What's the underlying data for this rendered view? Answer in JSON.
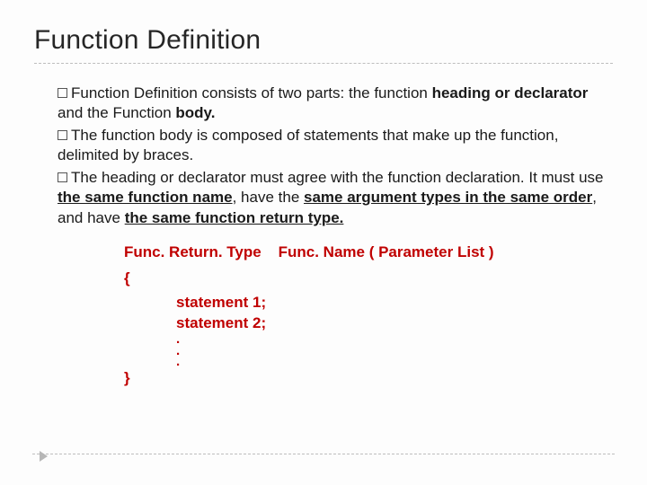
{
  "title": "Function Definition",
  "bullets": {
    "b1": {
      "lead": "Function Definition consists of two parts: the function ",
      "bold1": "heading or declarator",
      "mid1": " and the Function ",
      "bold2": "body."
    },
    "b2": {
      "text": "The function body is composed of statements that make up the function, delimited by braces."
    },
    "b3": {
      "lead": "The heading or declarator must agree with the function declaration. It must use ",
      "u1": "the same function name",
      "mid1": ", have the ",
      "u2": "same argument types in the same order",
      "mid2": ", and have ",
      "u3": "the same function return type."
    }
  },
  "code": {
    "ret": "Func. Return. Type",
    "name": "Func. Name ( Parameter List )",
    "open": "{",
    "s1": "statement 1;",
    "s2": "statement 2;",
    "d": ".",
    "close": "}"
  }
}
